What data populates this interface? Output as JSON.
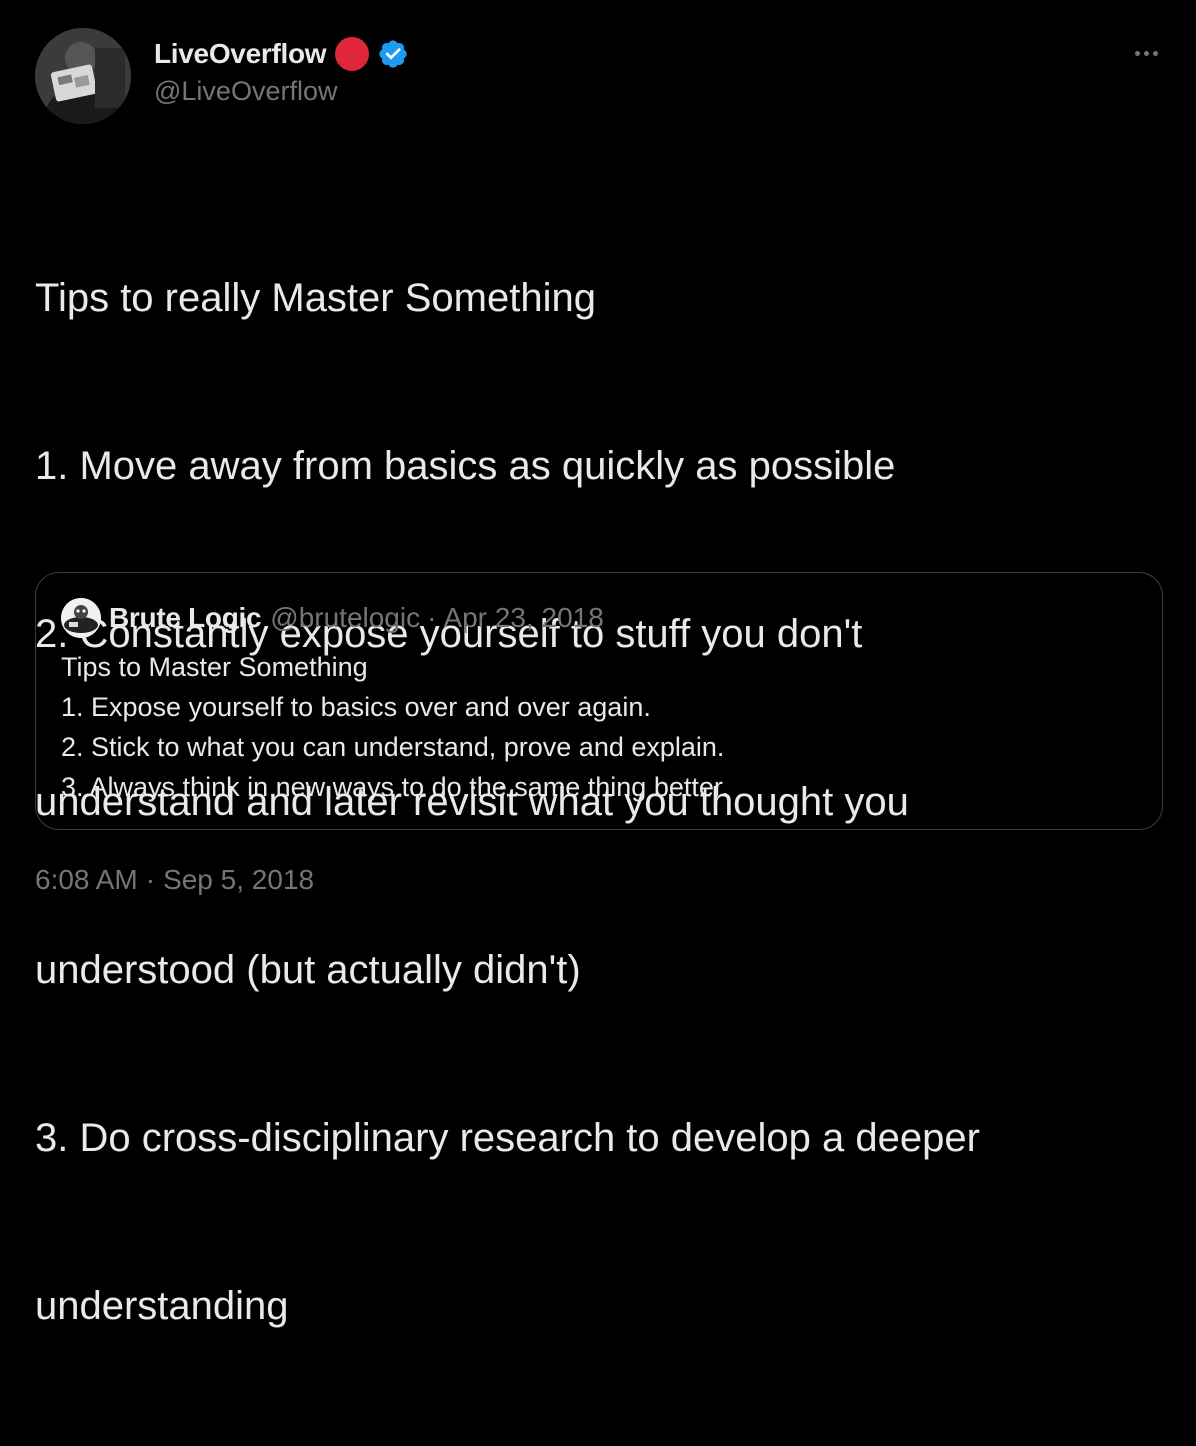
{
  "tweet": {
    "author": {
      "name": "LiveOverflow",
      "handle": "@LiveOverflow",
      "avatar_icon": "profile-photo",
      "live_badge_color": "#e0263a",
      "verified_color": "#1d9bf0"
    },
    "more_icon": "more-horizontal-icon",
    "text_lines": [
      "Tips to really Master Something",
      "1. Move away from basics as quickly as possible",
      "2. Constantly expose yourself to stuff you don't",
      "understand and later revisit what you thought you",
      "understood (but actually didn't)",
      "3. Do cross-disciplinary research to develop a deeper",
      "understanding"
    ],
    "quoted": {
      "name": "Brute Logic",
      "handle": "@brutelogic",
      "separator": "·",
      "date": "Apr 23, 2018",
      "text_lines": [
        "Tips to Master Something",
        "1. Expose yourself to basics over and over again.",
        "2. Stick to what you can understand, prove and explain.",
        "3. Always think in new ways to do the same thing better."
      ]
    },
    "time": "6:08 AM",
    "separator": "·",
    "date": "Sep 5, 2018"
  },
  "colors": {
    "background": "#000000",
    "primary_text": "#e7e9ea",
    "secondary_text": "#71767b",
    "border": "#3a3d41"
  }
}
